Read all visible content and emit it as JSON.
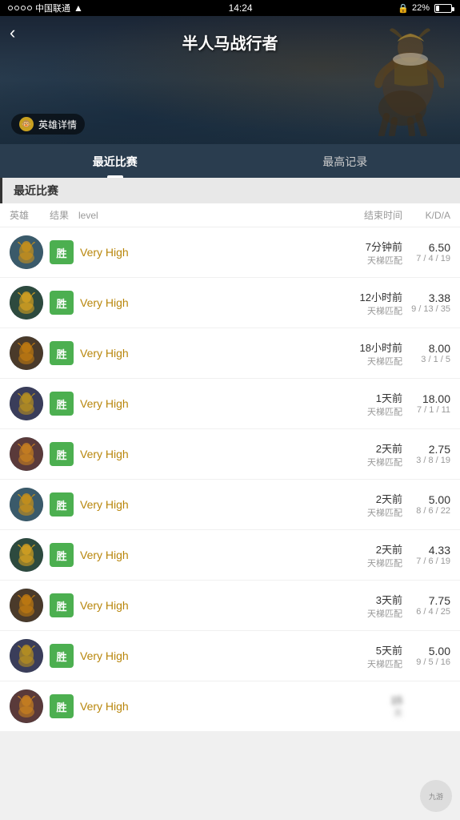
{
  "statusBar": {
    "carrier": "中国联通",
    "time": "14:24",
    "battery": "22%"
  },
  "hero": {
    "title": "半人马战行者",
    "badge": "英雄详情",
    "backLabel": "‹"
  },
  "tabs": [
    {
      "id": "recent",
      "label": "最近比赛",
      "active": true
    },
    {
      "id": "best",
      "label": "最高记录",
      "active": false
    }
  ],
  "sectionHeader": "最近比赛",
  "tableHeaders": {
    "hero": "英雄",
    "result": "结果",
    "level": "level",
    "time": "结束时间",
    "kda": "K/D/A"
  },
  "matches": [
    {
      "id": 1,
      "result": "胜",
      "won": true,
      "level": "Very High",
      "timeMain": "7分钟前",
      "timeSub": "天梯匹配",
      "kdaRatio": "6.50",
      "kdaDetail": "7 / 4 / 19"
    },
    {
      "id": 2,
      "result": "胜",
      "won": true,
      "level": "Very High",
      "timeMain": "12小时前",
      "timeSub": "天梯匹配",
      "kdaRatio": "3.38",
      "kdaDetail": "9 / 13 / 35"
    },
    {
      "id": 3,
      "result": "胜",
      "won": true,
      "level": "Very High",
      "timeMain": "18小时前",
      "timeSub": "天梯匹配",
      "kdaRatio": "8.00",
      "kdaDetail": "3 / 1 / 5"
    },
    {
      "id": 4,
      "result": "胜",
      "won": true,
      "level": "Very High",
      "timeMain": "1天前",
      "timeSub": "天梯匹配",
      "kdaRatio": "18.00",
      "kdaDetail": "7 / 1 / 11"
    },
    {
      "id": 5,
      "result": "胜",
      "won": true,
      "level": "Very High",
      "timeMain": "2天前",
      "timeSub": "天梯匹配",
      "kdaRatio": "2.75",
      "kdaDetail": "3 / 8 / 19"
    },
    {
      "id": 6,
      "result": "胜",
      "won": true,
      "level": "Very High",
      "timeMain": "2天前",
      "timeSub": "天梯匹配",
      "kdaRatio": "5.00",
      "kdaDetail": "8 / 6 / 22"
    },
    {
      "id": 7,
      "result": "胜",
      "won": true,
      "level": "Very High",
      "timeMain": "2天前",
      "timeSub": "天梯匹配",
      "kdaRatio": "4.33",
      "kdaDetail": "7 / 6 / 19"
    },
    {
      "id": 8,
      "result": "胜",
      "won": true,
      "level": "Very High",
      "timeMain": "3天前",
      "timeSub": "天梯匹配",
      "kdaRatio": "7.75",
      "kdaDetail": "6 / 4 / 25"
    },
    {
      "id": 9,
      "result": "胜",
      "won": true,
      "level": "Very High",
      "timeMain": "5天前",
      "timeSub": "天梯匹配",
      "kdaRatio": "5.00",
      "kdaDetail": "9 / 5 / 16"
    },
    {
      "id": 10,
      "result": "胜",
      "won": true,
      "level": "Very High",
      "timeMain": "15",
      "timeSub": "天",
      "kdaRatio": "",
      "kdaDetail": "",
      "blurred": true
    }
  ],
  "colors": {
    "win": "#4caf50",
    "loss": "#f44336",
    "level": "#b8860b",
    "accent": "#2a3d4f"
  }
}
